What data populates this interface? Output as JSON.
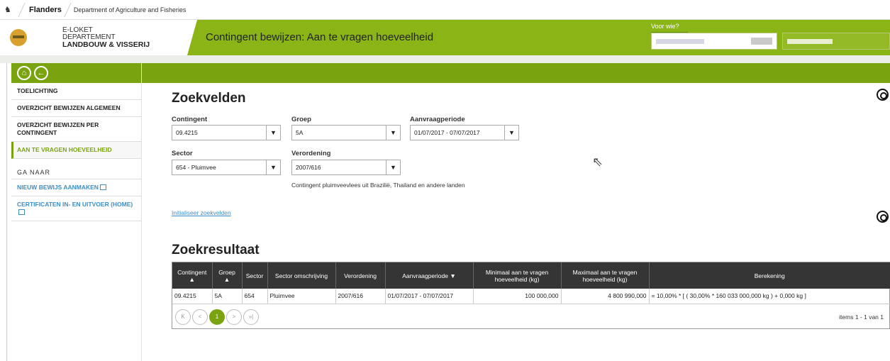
{
  "topbar": {
    "flanders": "Flanders",
    "department": "Department of Agriculture and Fisheries"
  },
  "header": {
    "brand_line1": "E-LOKET",
    "brand_line2": "DEPARTEMENT",
    "brand_line3": "LANDBOUW & VISSERIJ",
    "title": "Contingent bewijzen: Aan te vragen hoeveelheid",
    "voor_wie_label": "Voor wie?"
  },
  "sidebar": {
    "items": [
      {
        "label": "TOELICHTING"
      },
      {
        "label": "OVERZICHT BEWIJZEN ALGEMEEN"
      },
      {
        "label": "OVERZICHT BEWIJZEN PER CONTINGENT"
      },
      {
        "label": "AAN TE VRAGEN HOEVEELHEID"
      }
    ],
    "ga_naar": "GA NAAR",
    "links": [
      {
        "label": "NIEUW BEWIJS AANMAKEN"
      },
      {
        "label": "CERTIFICATEN IN- EN UITVOER (HOME)"
      }
    ]
  },
  "search": {
    "title": "Zoekvelden",
    "contingent_label": "Contingent",
    "contingent_value": "09.4215",
    "groep_label": "Groep",
    "groep_value": "5A",
    "periode_label": "Aanvraagperiode",
    "periode_value": "01/07/2017 - 07/07/2017",
    "sector_label": "Sector",
    "sector_value": "654 - Pluimvee",
    "verordening_label": "Verordening",
    "verordening_value": "2007/616",
    "note": "Contingent pluimveevlees uit Brazilië, Thailand en andere landen",
    "reset_link": "Initialiseer zoekvelden"
  },
  "results": {
    "title": "Zoekresultaat",
    "headers": {
      "contingent": "Contingent ▲",
      "groep": "Groep ▲",
      "sector": "Sector",
      "omschrijving": "Sector omschrijving",
      "verordening": "Verordening",
      "periode": "Aanvraagperiode ▼",
      "min": "Minimaal aan te vragen hoeveelheid (kg)",
      "max": "Maximaal aan te vragen hoeveelheid (kg)",
      "berekening": "Berekening"
    },
    "row": {
      "contingent": "09.4215",
      "groep": "5A",
      "sector": "654",
      "omschrijving": "Pluimvee",
      "verordening": "2007/616",
      "periode": "01/07/2017 - 07/07/2017",
      "min": "100 000,000",
      "max": "4 800 990,000",
      "berekening": "= 10,00% * [ ( 30,00% * 160 033 000,000 kg ) + 0,000 kg ]"
    },
    "pager": {
      "first": "K",
      "prev": "<",
      "current": "1",
      "next": ">",
      "last": "»|",
      "items": "items 1 - 1 van 1"
    }
  }
}
